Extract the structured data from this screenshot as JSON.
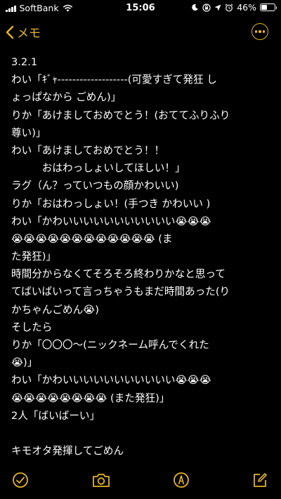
{
  "status_bar": {
    "carrier": "SoftBank",
    "time": "15:06",
    "battery": "46%",
    "battery_level": 0.46,
    "icons": [
      "signal-icon",
      "wifi-icon",
      "do-not-disturb-icon",
      "rotation-lock-icon",
      "location-icon",
      "alarm-icon",
      "battery-icon"
    ]
  },
  "nav": {
    "back_label": "メモ",
    "accent_color": "#e6b426",
    "icons": [
      "chevron-left-icon",
      "more-icon"
    ]
  },
  "note": {
    "lines": [
      "3.2.1",
      "わい「ｷﾞｬ-------------------(可愛すぎて発狂 し",
      "ょっぱなから ごめん)」",
      "りか「あけましておめでとう！(おててふりふり",
      "尊い)」",
      "わい「あけましておめでとう！！",
      "　　　おはわっしょいしてほしい！」",
      "ラグ（ん？っていつもの顔かわいい)",
      "りか「おはわっしょい！(手つき かわいい )",
      "わい「かわいいいいいいいいいいい😭😭😭",
      "😭😭😭😭😭😭😭😭😭😭😭😭 (ま",
      "た発狂)」",
      "時間分からなくてそろそろ終わりかなと思って",
      "てばいばいって言っちゃうもまだ時間あった(り",
      "かちゃんごめん😭)",
      "そしたら",
      "りか「〇〇〇〜(ニックネーム呼んでくれた",
      "😭)」",
      "わい「かわいいいいいいいいいいい😭😭😭",
      "😭😭😭😭😭😭😭😭 (また発狂)」",
      "2人「ばいばーい」",
      "",
      "キモオタ発揮してごめん"
    ]
  },
  "toolbar": {
    "icons": [
      "checklist-icon",
      "camera-icon",
      "markup-icon",
      "compose-icon"
    ]
  }
}
